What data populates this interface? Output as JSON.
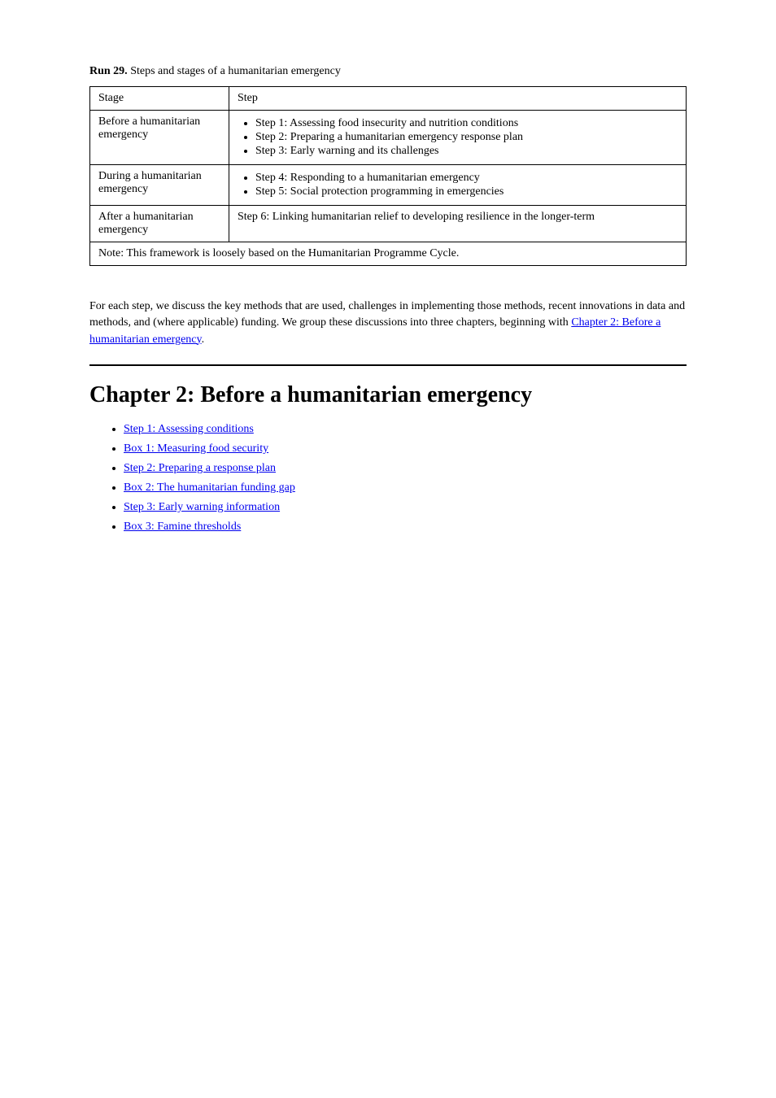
{
  "run_header": {
    "label": "Run 29.",
    "text": "Steps and stages of a humanitarian emergency"
  },
  "table": {
    "headers": {
      "col1": "Stage",
      "col2": "Step"
    },
    "rows": [
      {
        "stage": "Before a humanitarian emergency",
        "steps": [
          "Step 1: Assessing food insecurity and nutrition conditions",
          "Step 2: Preparing a humanitarian emergency response plan",
          "Step 3: Early warning and its challenges"
        ]
      },
      {
        "stage": "During a humanitarian emergency",
        "steps": [
          "Step 4: Responding to a humanitarian emergency",
          "Step 5: Social protection programming in emergencies"
        ]
      },
      {
        "stage": "After a humanitarian emergency",
        "steps": [
          "Step 6: Linking humanitarian relief to developing resilience in the longer-term"
        ]
      }
    ],
    "note": "Note: This framework is loosely based on the Humanitarian Programme Cycle."
  },
  "intro": {
    "part1": "For each step, we discuss the key methods that are used, challenges in implementing those methods, recent innovations in data and methods, and (where applicable) funding. We group these discussions into three chapters, beginning with ",
    "link1_text": "Chapter 2: Before a humanitarian emergency",
    "part2": "."
  },
  "chapter": {
    "title": "Chapter 2: Before a humanitarian emergency",
    "links": [
      "Step 1: Assessing conditions",
      "Box 1: Measuring food security",
      "Step 2: Preparing a response plan",
      "Box 2: The humanitarian funding gap",
      "Step 3: Early warning information",
      "Box 3: Famine thresholds"
    ]
  }
}
